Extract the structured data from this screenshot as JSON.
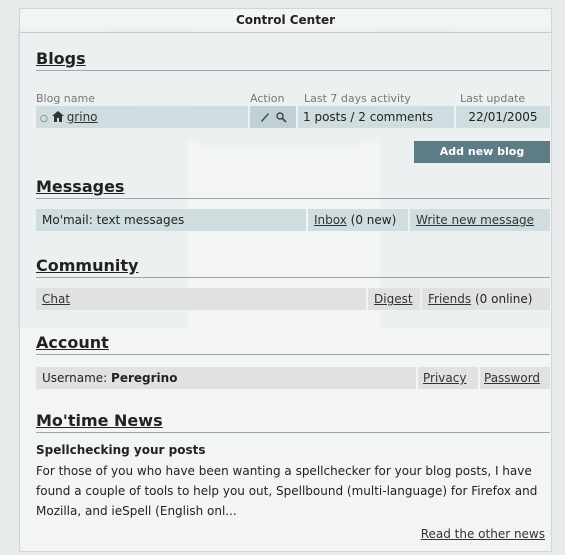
{
  "window": {
    "title": "Control Center"
  },
  "blogs": {
    "heading": "Blogs",
    "columns": {
      "name": "Blog name",
      "action": "Action",
      "activity": "Last 7 days activity",
      "update": "Last update"
    },
    "rows": [
      {
        "name": "grino",
        "activity": "1 posts / 2 comments",
        "update": "22/01/2005"
      }
    ],
    "add_button": "Add new blog"
  },
  "messages": {
    "heading": "Messages",
    "label": "Mo'mail: text messages",
    "inbox": "Inbox",
    "inbox_count": "(0 new)",
    "write": "Write new message"
  },
  "community": {
    "heading": "Community",
    "chat": "Chat",
    "digest": "Digest",
    "friends": "Friends",
    "friends_count": "(0 online)"
  },
  "account": {
    "heading": "Account",
    "username_label": "Username:",
    "username": "Peregrino",
    "privacy": "Privacy",
    "password": "Password"
  },
  "news": {
    "heading": "Mo'time News",
    "post_title": "Spellchecking your posts",
    "post_body": "For those of you who have been wanting a spellchecker for your blog posts, I have found a couple of tools to help you out, Spellbound (multi-language) for Firefox and Mozilla, and ieSpell (English onl...",
    "read_more": "Read the other news"
  },
  "icons": {
    "bullet": "bullet-icon",
    "home": "home-icon",
    "edit": "pencil-icon",
    "view": "magnifier-icon"
  }
}
